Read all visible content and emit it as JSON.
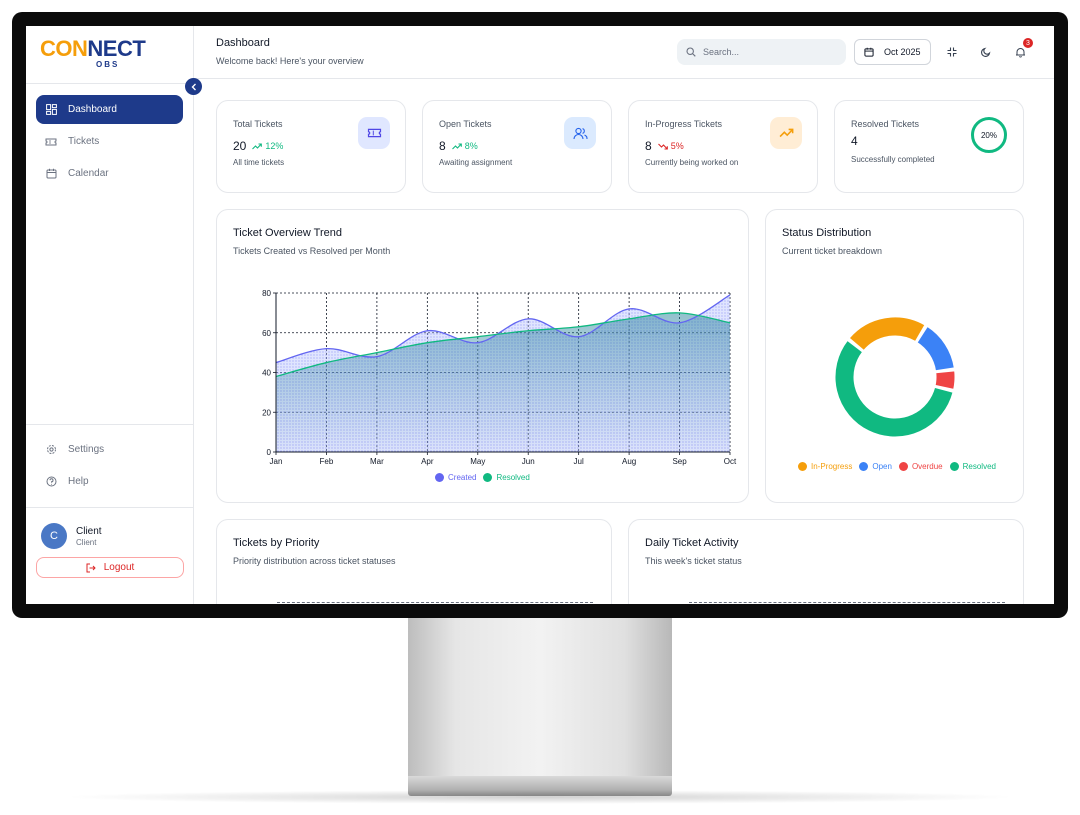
{
  "brand": {
    "logo_main": "CON",
    "logo_accent": "NECT",
    "logo_sub": "OBS"
  },
  "sidebar": {
    "items": [
      {
        "label": "Dashboard",
        "icon": "dashboard-icon",
        "active": true
      },
      {
        "label": "Tickets",
        "icon": "ticket-icon"
      },
      {
        "label": "Calendar",
        "icon": "calendar-icon"
      }
    ],
    "bottom_items": [
      {
        "label": "Settings",
        "icon": "gear-icon"
      },
      {
        "label": "Help",
        "icon": "help-icon"
      }
    ],
    "user": {
      "initial": "C",
      "name": "Client",
      "role": "Client"
    },
    "logout_label": "Logout"
  },
  "header": {
    "title": "Dashboard",
    "subtitle": "Welcome back! Here's your overview",
    "search_placeholder": "Search...",
    "date_label": "Oct 2025",
    "notification_count": "3"
  },
  "stats": [
    {
      "label": "Total Tickets",
      "value": "20",
      "trend": "12%",
      "trend_dir": "up",
      "desc": "All time tickets",
      "icon": "ticket-icon"
    },
    {
      "label": "Open Tickets",
      "value": "8",
      "trend": "8%",
      "trend_dir": "up",
      "desc": "Awaiting assignment",
      "icon": "users-icon"
    },
    {
      "label": "In-Progress Tickets",
      "value": "8",
      "trend": "5%",
      "trend_dir": "down",
      "desc": "Currently being worked on",
      "icon": "trending-up-icon"
    },
    {
      "label": "Resolved Tickets",
      "value": "4",
      "desc": "Successfully completed",
      "ring_label": "20%",
      "percent": 20
    }
  ],
  "colors": {
    "brand": "#1e3a8a",
    "accent": "#f59e0b",
    "created": "#6366f1",
    "resolved": "#10b981",
    "in_progress": "#f59e0b",
    "open": "#3b82f6",
    "overdue": "#ef4444",
    "trend_up": "#10b981",
    "trend_down": "#dc2626"
  },
  "trend_card": {
    "title": "Ticket Overview Trend",
    "subtitle": "Tickets Created vs Resolved per Month"
  },
  "status_card": {
    "title": "Status Distribution",
    "subtitle": "Current ticket breakdown"
  },
  "priority_card": {
    "title": "Tickets by Priority",
    "subtitle": "Priority distribution across ticket statuses"
  },
  "daily_card": {
    "title": "Daily Ticket Activity",
    "subtitle": "This week's ticket status"
  },
  "chart_data": [
    {
      "type": "area",
      "title": "Ticket Overview Trend",
      "subtitle": "Tickets Created vs Resolved per Month",
      "categories": [
        "Jan",
        "Feb",
        "Mar",
        "Apr",
        "May",
        "Jun",
        "Jul",
        "Aug",
        "Sep",
        "Oct"
      ],
      "y_ticks": [
        "0",
        "20",
        "40",
        "60",
        "80"
      ],
      "ylim": [
        0,
        80
      ],
      "grid": true,
      "legend_position": "bottom",
      "series": [
        {
          "name": "Created",
          "values": [
            45,
            52,
            48,
            61,
            55,
            67,
            58,
            72,
            65,
            79
          ]
        },
        {
          "name": "Resolved",
          "values": [
            38,
            45,
            50,
            55,
            58,
            61,
            63,
            67,
            70,
            65
          ]
        }
      ]
    },
    {
      "type": "pie",
      "title": "Status Distribution",
      "subtitle": "Current ticket breakdown",
      "donut": true,
      "legend_position": "bottom",
      "slices": [
        {
          "name": "In-Progress",
          "value": 8
        },
        {
          "name": "Open",
          "value": 5
        },
        {
          "name": "Overdue",
          "value": 2
        },
        {
          "name": "Resolved",
          "value": 20
        }
      ]
    }
  ]
}
